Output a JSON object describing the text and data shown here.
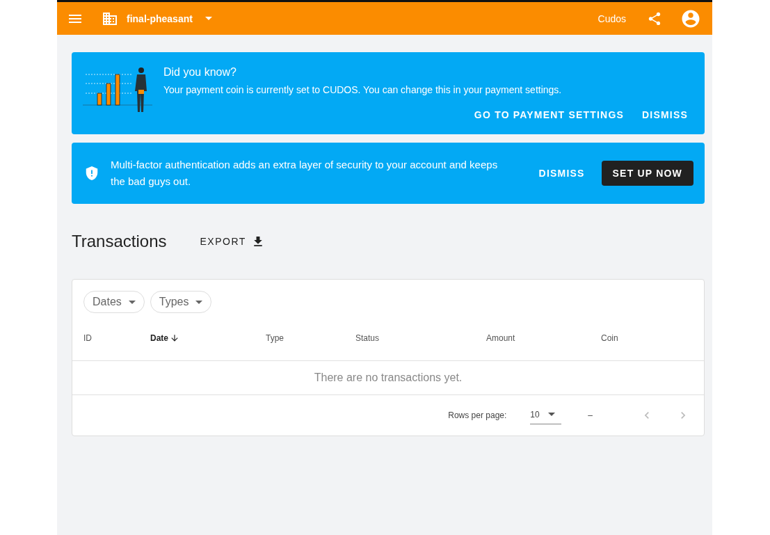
{
  "app_bar": {
    "project": "final-pheasant",
    "coin": "Cudos"
  },
  "tip_banner": {
    "title": "Did you know?",
    "text": "Your payment coin is currently set to CUDOS. You can change this in your payment settings.",
    "actions": [
      "GO TO PAYMENT SETTINGS",
      "DISMISS"
    ]
  },
  "mfa_banner": {
    "text": "Multi-factor authentication adds an extra layer of security to your account and keeps the bad guys out.",
    "dismiss": "DISMISS",
    "primary": "SET UP NOW"
  },
  "transactions": {
    "title": "Transactions",
    "export": "EXPORT",
    "filters": [
      "Dates",
      "Types"
    ],
    "columns": [
      {
        "label": "ID",
        "sorted": false
      },
      {
        "label": "Date",
        "sorted": true
      },
      {
        "label": "Type",
        "sorted": false
      },
      {
        "label": "Status",
        "sorted": false
      },
      {
        "label": "Amount",
        "sorted": false
      },
      {
        "label": "Coin",
        "sorted": false
      }
    ],
    "empty_text": "There are no transactions yet.",
    "pagination": {
      "rows_label": "Rows per page:",
      "rows_value": "10",
      "range": "–",
      "prev_disabled": true,
      "next_disabled": true
    }
  }
}
